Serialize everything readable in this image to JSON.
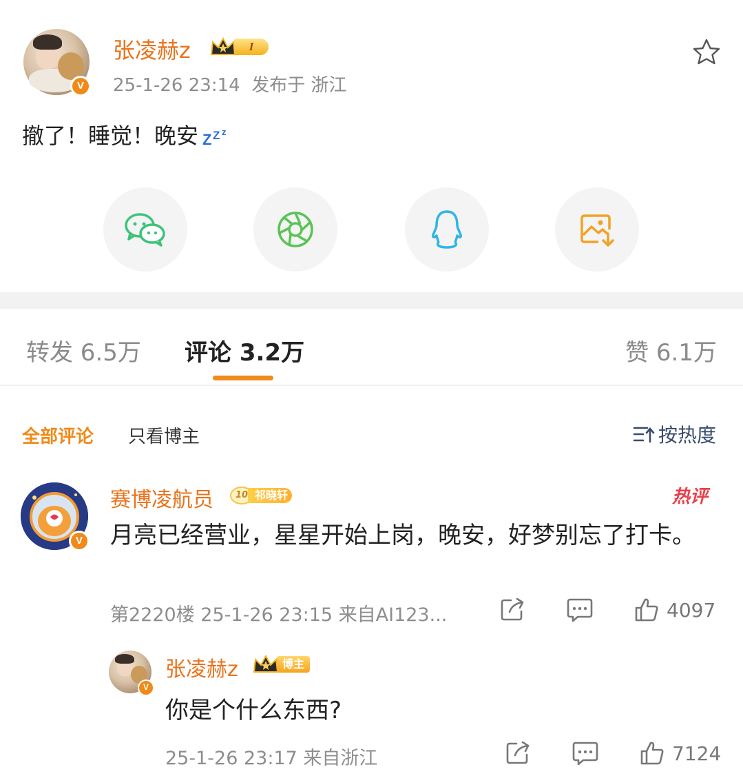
{
  "post": {
    "author": "张凌赫z",
    "level": "I",
    "meta": "25-1-26 23:14  发布于 浙江",
    "text": "撤了！睡觉！晚安",
    "icons": {
      "favorite": "star-icon",
      "sleep": "zzz-emoji",
      "verified": "verified-v-icon"
    }
  },
  "share": [
    {
      "name": "wechat",
      "icon": "wechat-icon",
      "color": "#3cc37a"
    },
    {
      "name": "moments",
      "icon": "moments-icon",
      "color": "#5ac356"
    },
    {
      "name": "qq",
      "icon": "qq-icon",
      "color": "#2fb4e8"
    },
    {
      "name": "save-image",
      "icon": "save-image-icon",
      "color": "#f2a225"
    }
  ],
  "tabs": {
    "repost": "转发 6.5万",
    "comments": "评论 3.2万",
    "likes": "赞 6.1万"
  },
  "filter": {
    "all": "全部评论",
    "owner_only": "只看博主",
    "sort": "按热度"
  },
  "comment": {
    "author": "赛博凌航员",
    "fan_level": "10",
    "fan_group": "祁晓轩",
    "hot_tag": "热评",
    "text": "月亮已经营业，星星开始上岗，晚安，好梦别忘了打卡。",
    "meta": "第2220楼 25-1-26 23:15 来自AI123...",
    "likes": "4097"
  },
  "reply": {
    "author": "张凌赫z",
    "tag": "博主",
    "text": "你是个什么东西?",
    "meta": "25-1-26 23:17 来自浙江",
    "likes": "7124"
  },
  "colors": {
    "accent": "#f08a1a",
    "name": "#e8731c",
    "muted": "#8d8d8d",
    "hot": "#e8404a"
  }
}
